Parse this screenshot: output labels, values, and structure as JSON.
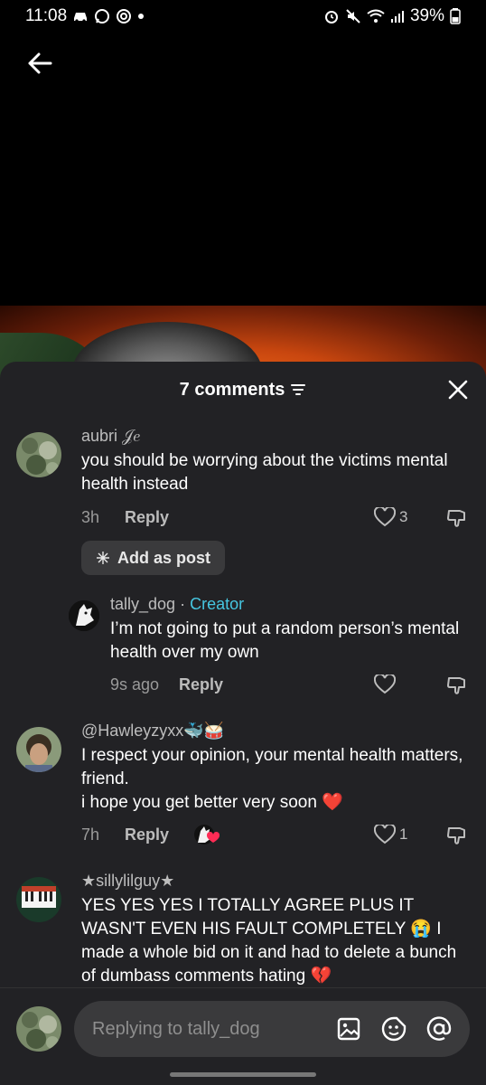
{
  "status_bar": {
    "time": "11:08",
    "battery": "39%",
    "icons": [
      "car-icon",
      "whatsapp-icon",
      "threads-icon",
      "dot-icon",
      "alarm-icon",
      "mute-icon",
      "wifi-icon",
      "signal-icon",
      "battery-icon"
    ]
  },
  "header": {
    "comments_count": "7 comments"
  },
  "comments": [
    {
      "username": "aubri 𝒥𝑒",
      "text": "you should be worrying about the victims mental health instead",
      "time": "3h",
      "reply_label": "Reply",
      "likes": "3"
    },
    {
      "username": "tally_dog",
      "separator": "·",
      "creator_label": "Creator",
      "text": "I’m not going to put a random person’s mental health over my own",
      "time": "9s ago",
      "reply_label": "Reply",
      "likes": ""
    },
    {
      "username": "@Hawleyzyxx🐳🥁",
      "text_line1": "I respect your opinion, your mental health matters, friend.",
      "text_line2": "i hope you get better very soon ❤️",
      "time": "7h",
      "reply_label": "Reply",
      "likes": "1"
    },
    {
      "username": "★sillylilguy★",
      "text": "YES YES YES I TOTALLY AGREE PLUS IT WASN'T EVEN HIS FAULT COMPLETELY 😭 I made a whole bid on it and had to delete a bunch of dumbass comments hating 💔"
    }
  ],
  "add_as_post_label": "Add as post",
  "reply_input": {
    "placeholder": "Replying to tally_dog"
  },
  "colors": {
    "sheet_bg": "#222225",
    "creator_accent": "#46c6e0",
    "input_bg": "#3a3a3c"
  }
}
